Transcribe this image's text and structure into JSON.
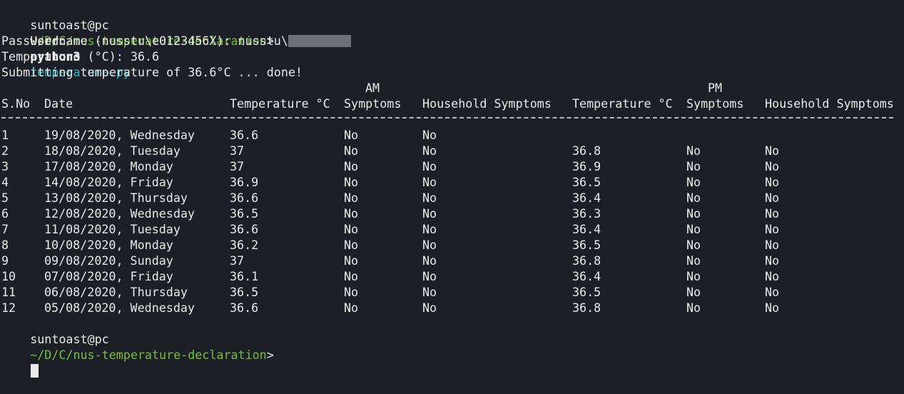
{
  "prompt": {
    "user_host": "suntoast@pc",
    "path": "~/D/C/nus-temperature-declaration",
    "symbol": ">"
  },
  "command": {
    "program": "python3",
    "script": "temperature.py"
  },
  "output": {
    "username_prompt": "Username (nusstu\\e0123456X): nusstu\\",
    "password_prompt": "Password:",
    "temperature_prompt": "Temperature (°C): 36.6",
    "submit_message": "Submitting temperature of 36.6°C ... done!"
  },
  "table": {
    "group_headers": {
      "am": "AM",
      "pm": "PM"
    },
    "columns": {
      "sno": "S.No",
      "date": "Date",
      "am_temp": "Temperature °C",
      "am_symptoms": "Symptoms",
      "am_household": "Household Symptoms",
      "pm_temp": "Temperature °C",
      "pm_symptoms": "Symptoms",
      "pm_household": "Household Symptoms"
    },
    "rows": [
      {
        "sno": "1",
        "date": "19/08/2020, Wednesday",
        "am_temp": "36.6",
        "am_symptoms": "No",
        "am_household": "No",
        "pm_temp": "",
        "pm_symptoms": "",
        "pm_household": ""
      },
      {
        "sno": "2",
        "date": "18/08/2020, Tuesday",
        "am_temp": "37",
        "am_symptoms": "No",
        "am_household": "No",
        "pm_temp": "36.8",
        "pm_symptoms": "No",
        "pm_household": "No"
      },
      {
        "sno": "3",
        "date": "17/08/2020, Monday",
        "am_temp": "37",
        "am_symptoms": "No",
        "am_household": "No",
        "pm_temp": "36.9",
        "pm_symptoms": "No",
        "pm_household": "No"
      },
      {
        "sno": "4",
        "date": "14/08/2020, Friday",
        "am_temp": "36.9",
        "am_symptoms": "No",
        "am_household": "No",
        "pm_temp": "36.5",
        "pm_symptoms": "No",
        "pm_household": "No"
      },
      {
        "sno": "5",
        "date": "13/08/2020, Thursday",
        "am_temp": "36.6",
        "am_symptoms": "No",
        "am_household": "No",
        "pm_temp": "36.4",
        "pm_symptoms": "No",
        "pm_household": "No"
      },
      {
        "sno": "6",
        "date": "12/08/2020, Wednesday",
        "am_temp": "36.5",
        "am_symptoms": "No",
        "am_household": "No",
        "pm_temp": "36.3",
        "pm_symptoms": "No",
        "pm_household": "No"
      },
      {
        "sno": "7",
        "date": "11/08/2020, Tuesday",
        "am_temp": "36.6",
        "am_symptoms": "No",
        "am_household": "No",
        "pm_temp": "36.4",
        "pm_symptoms": "No",
        "pm_household": "No"
      },
      {
        "sno": "8",
        "date": "10/08/2020, Monday",
        "am_temp": "36.2",
        "am_symptoms": "No",
        "am_household": "No",
        "pm_temp": "36.5",
        "pm_symptoms": "No",
        "pm_household": "No"
      },
      {
        "sno": "9",
        "date": "09/08/2020, Sunday",
        "am_temp": "37",
        "am_symptoms": "No",
        "am_household": "No",
        "pm_temp": "36.8",
        "pm_symptoms": "No",
        "pm_household": "No"
      },
      {
        "sno": "10",
        "date": "07/08/2020, Friday",
        "am_temp": "36.1",
        "am_symptoms": "No",
        "am_household": "No",
        "pm_temp": "36.4",
        "pm_symptoms": "No",
        "pm_household": "No"
      },
      {
        "sno": "11",
        "date": "06/08/2020, Thursday",
        "am_temp": "36.5",
        "am_symptoms": "No",
        "am_household": "No",
        "pm_temp": "36.5",
        "pm_symptoms": "No",
        "pm_household": "No"
      },
      {
        "sno": "12",
        "date": "05/08/2020, Wednesday",
        "am_temp": "36.6",
        "am_symptoms": "No",
        "am_household": "No",
        "pm_temp": "36.8",
        "pm_symptoms": "No",
        "pm_household": "No"
      }
    ]
  },
  "colors": {
    "background": "#1c1f26",
    "foreground": "#eaeaea",
    "path": "#74bf3e",
    "argument": "#2bb7c2"
  }
}
